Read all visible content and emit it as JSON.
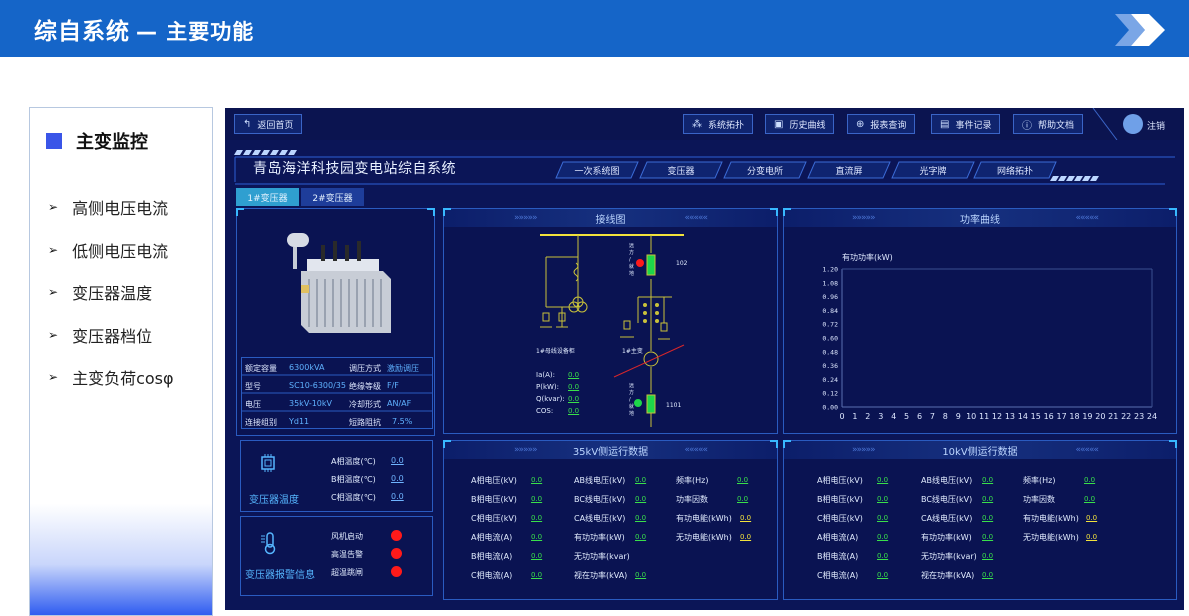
{
  "slide": {
    "title": "综自系统",
    "subtitle": "— 主要功能",
    "header_color": "#1565c8"
  },
  "outline": {
    "title": "主变监控",
    "items": [
      {
        "label": "高侧电压电流"
      },
      {
        "label": "低侧电压电流"
      },
      {
        "label": "变压器温度"
      },
      {
        "label": "变压器档位"
      },
      {
        "label": "主变负荷cosφ"
      }
    ]
  },
  "dashboard": {
    "back_button": "返回首页",
    "toolbar": [
      {
        "label": "系统拓扑",
        "icon": "topology-icon"
      },
      {
        "label": "历史曲线",
        "icon": "chart-icon"
      },
      {
        "label": "报表查询",
        "icon": "search-icon"
      },
      {
        "label": "事件记录",
        "icon": "document-icon"
      },
      {
        "label": "帮助文档",
        "icon": "help-icon"
      }
    ],
    "logout": "注销",
    "system_title": "青岛海洋科技园变电站综自系统",
    "nav_tabs": [
      "一次系统图",
      "变压器",
      "分变电所",
      "直流屏",
      "光字牌",
      "网络拓扑"
    ],
    "transformer_tabs": [
      {
        "label": "1#变压器",
        "active": true
      },
      {
        "label": "2#变压器",
        "active": false
      }
    ],
    "specs": [
      {
        "label": "额定容量",
        "value": "6300kVA",
        "label2": "调压方式",
        "value2": "激励调压"
      },
      {
        "label": "型号",
        "value": "SC10-6300/35",
        "label2": "绝缘等级",
        "value2": "F/F"
      },
      {
        "label": "电压",
        "value": "35kV-10kV",
        "label2": "冷却形式",
        "value2": "AN/AF"
      },
      {
        "label": "连接组别",
        "value": "Yd11",
        "label2": "短路阻抗",
        "value2": "7.5%"
      }
    ],
    "temperature": {
      "title": "变压器温度",
      "rows": [
        {
          "label": "A相温度(℃)",
          "value": "0.0"
        },
        {
          "label": "B相温度(℃)",
          "value": "0.0"
        },
        {
          "label": "C相温度(℃)",
          "value": "0.0"
        }
      ]
    },
    "alarm": {
      "title": "变压器报警信息",
      "rows": [
        {
          "label": "风机启动",
          "color": "#ff1a1a"
        },
        {
          "label": "高温告警",
          "color": "#ff1a1a"
        },
        {
          "label": "超温跳闸",
          "color": "#ff1a1a"
        }
      ]
    },
    "wiring": {
      "title": "接线图",
      "labels": {
        "bus_cabinet": "1#母线设备柜",
        "main_tx": "1#主变",
        "breaker_top": "102",
        "breaker_bottom": "1101",
        "remote_local": "远\n方\n/\n就\n地"
      },
      "readings": [
        {
          "label": "Ia(A):",
          "value": "0.0"
        },
        {
          "label": "P(kW):",
          "value": "0.0"
        },
        {
          "label": "Q(kvar):",
          "value": "0.0"
        },
        {
          "label": "COS:",
          "value": "0.0"
        }
      ]
    },
    "power_curve": {
      "title": "功率曲线"
    },
    "hv_data": {
      "title": "35kV侧运行数据",
      "col1": [
        {
          "label": "A相电压(kV)",
          "value": "0.0"
        },
        {
          "label": "B相电压(kV)",
          "value": "0.0"
        },
        {
          "label": "C相电压(kV)",
          "value": "0.0"
        },
        {
          "label": "A相电流(A)",
          "value": "0.0"
        },
        {
          "label": "B相电流(A)",
          "value": "0.0"
        },
        {
          "label": "C相电流(A)",
          "value": "0.0"
        }
      ],
      "col2": [
        {
          "label": "AB线电压(kV)",
          "value": "0.0"
        },
        {
          "label": "BC线电压(kV)",
          "value": "0.0"
        },
        {
          "label": "CA线电压(kV)",
          "value": "0.0"
        },
        {
          "label": "有功功率(kW)",
          "value": "0.0"
        },
        {
          "label": "无功功率(kvar)",
          "value": "0.0"
        },
        {
          "label": "视在功率(kVA)",
          "value": "0.0"
        }
      ],
      "col3": [
        {
          "label": "频率(Hz)",
          "value": "0.0"
        },
        {
          "label": "功率因数",
          "value": "0.0"
        },
        {
          "label": "有功电能(kWh)",
          "value": "0.0"
        },
        {
          "label": "无功电能(kWh)",
          "value": "0.0"
        }
      ]
    },
    "lv_data": {
      "title": "10kV侧运行数据",
      "col1": [
        {
          "label": "A相电压(kV)",
          "value": "0.0"
        },
        {
          "label": "B相电压(kV)",
          "value": "0.0"
        },
        {
          "label": "C相电压(kV)",
          "value": "0.0"
        },
        {
          "label": "A相电流(A)",
          "value": "0.0"
        },
        {
          "label": "B相电流(A)",
          "value": "0.0"
        },
        {
          "label": "C相电流(A)",
          "value": "0.0"
        }
      ],
      "col2": [
        {
          "label": "AB线电压(kV)",
          "value": "0.0"
        },
        {
          "label": "BC线电压(kV)",
          "value": "0.0"
        },
        {
          "label": "CA线电压(kV)",
          "value": "0.0"
        },
        {
          "label": "有功功率(kW)",
          "value": "0.0"
        },
        {
          "label": "无功功率(kvar)",
          "value": "0.0"
        },
        {
          "label": "视在功率(kVA)",
          "value": "0.0"
        }
      ],
      "col3": [
        {
          "label": "频率(Hz)",
          "value": "0.0"
        },
        {
          "label": "功率因数",
          "value": "0.0"
        },
        {
          "label": "有功电能(kWh)",
          "value": "0.0"
        },
        {
          "label": "无功电能(kWh)",
          "value": "0.0"
        }
      ]
    }
  },
  "chart_data": {
    "type": "line",
    "title": "有功功率(kW)",
    "xlabel": "",
    "ylabel": "有功功率(kW)",
    "x_ticks": [
      "0",
      "1",
      "2",
      "3",
      "4",
      "5",
      "6",
      "7",
      "8",
      "9",
      "10",
      "11",
      "12",
      "13",
      "14",
      "15",
      "16",
      "17",
      "18",
      "19",
      "20",
      "21",
      "22",
      "23",
      "24"
    ],
    "y_ticks": [
      "0.00",
      "0.12",
      "0.24",
      "0.36",
      "0.48",
      "0.60",
      "0.72",
      "0.84",
      "0.96",
      "1.08",
      "1.20"
    ],
    "xlim": [
      0,
      24
    ],
    "ylim": [
      0,
      1.2
    ],
    "series": [],
    "grid": false
  }
}
